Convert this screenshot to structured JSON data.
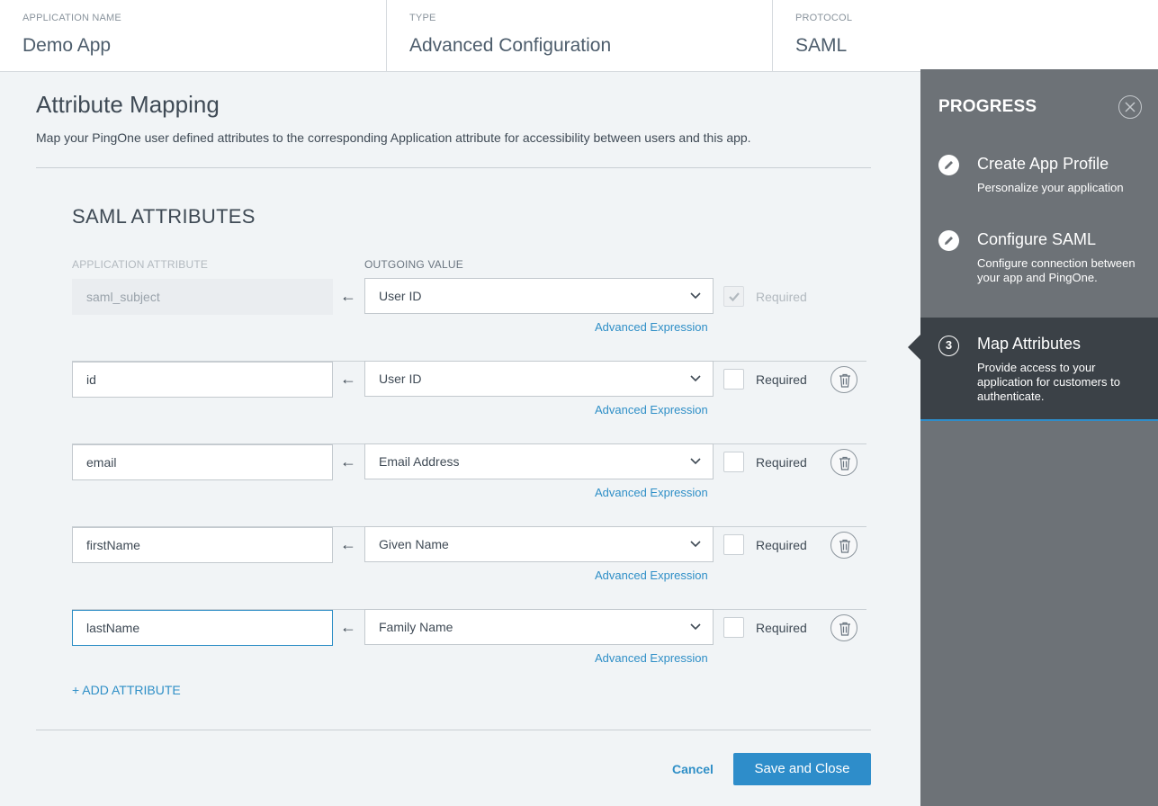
{
  "header": {
    "cells": [
      {
        "label": "APPLICATION NAME",
        "value": "Demo App"
      },
      {
        "label": "TYPE",
        "value": "Advanced Configuration"
      },
      {
        "label": "PROTOCOL",
        "value": "SAML"
      }
    ]
  },
  "main": {
    "title": "Attribute Mapping",
    "subtitle": "Map your PingOne user defined attributes to the corresponding Application attribute for accessibility between users and this app.",
    "section_title": "SAML ATTRIBUTES",
    "col_app_attr": "APPLICATION ATTRIBUTE",
    "col_outgoing": "OUTGOING VALUE",
    "arrow_glyph": "←",
    "rows": [
      {
        "attribute": "saml_subject",
        "outgoing": "User ID",
        "advanced": "Advanced Expression",
        "required_label": "Required",
        "required": true,
        "disabled": true
      },
      {
        "attribute": "id",
        "outgoing": "User ID",
        "advanced": "Advanced Expression",
        "required_label": "Required",
        "required": false,
        "disabled": false
      },
      {
        "attribute": "email",
        "outgoing": "Email Address",
        "advanced": "Advanced Expression",
        "required_label": "Required",
        "required": false,
        "disabled": false
      },
      {
        "attribute": "firstName",
        "outgoing": "Given Name",
        "advanced": "Advanced Expression",
        "required_label": "Required",
        "required": false,
        "disabled": false
      },
      {
        "attribute": "lastName",
        "outgoing": "Family Name",
        "advanced": "Advanced Expression",
        "required_label": "Required",
        "required": false,
        "disabled": false,
        "focused": true
      }
    ],
    "add_attribute": "+ ADD ATTRIBUTE",
    "cancel": "Cancel",
    "save": "Save and Close"
  },
  "progress": {
    "title": "PROGRESS",
    "steps": [
      {
        "icon": "pencil-icon",
        "title": "Create App Profile",
        "desc": "Personalize your application"
      },
      {
        "icon": "pencil-icon",
        "title": "Configure SAML",
        "desc": "Configure connection between your app and PingOne."
      },
      {
        "number": "3",
        "title": "Map Attributes",
        "desc": "Provide access to your application for customers to authenticate.",
        "active": true
      }
    ]
  },
  "colors": {
    "accent": "#2e8dca",
    "panel": "#6d7277",
    "panel_active": "#3b4147",
    "background": "#f1f4f6"
  }
}
